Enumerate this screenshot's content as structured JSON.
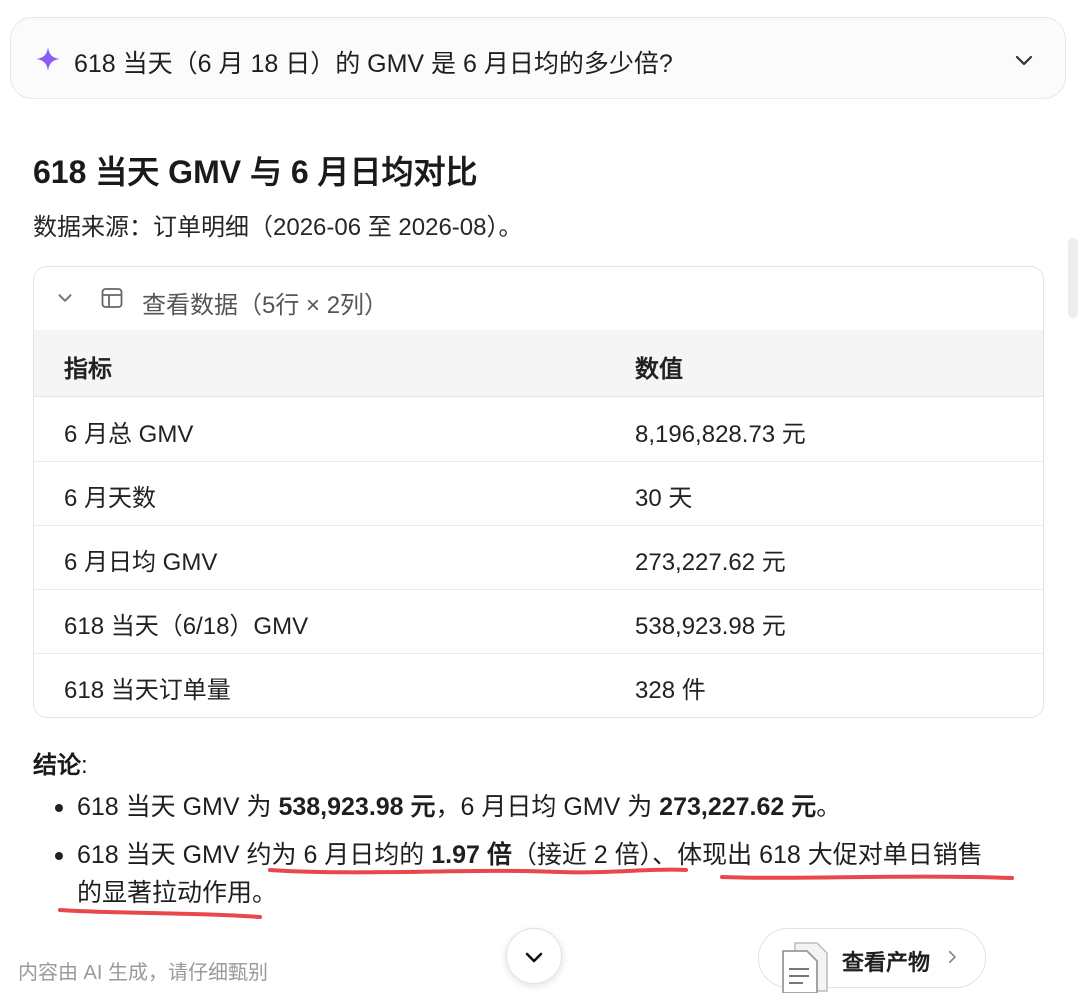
{
  "question": {
    "icon": "sparkle-icon",
    "text": "618 当天（6 月 18 日）的 GMV 是 6 月日均的多少倍?"
  },
  "answer": {
    "title": "618 当天 GMV 与 6 月日均对比",
    "source": "数据来源：订单明细（2026-06 至 2026-08）。"
  },
  "data_table": {
    "toggle_label": "查看数据（5行 × 2列）",
    "columns": [
      "指标",
      "数值"
    ],
    "rows": [
      [
        "6 月总 GMV",
        "8,196,828.73 元"
      ],
      [
        "6 月天数",
        "30 天"
      ],
      [
        "6 月日均 GMV",
        "273,227.62 元"
      ],
      [
        "618 当天（6/18）GMV",
        "538,923.98 元"
      ],
      [
        "618 当天订单量",
        "328 件"
      ]
    ]
  },
  "conclusion": {
    "label": "结论",
    "colon": ":",
    "bullet1": {
      "t1": "618 当天 GMV 为 ",
      "b1": "538,923.98 元",
      "t2": "，6 月日均 GMV 为 ",
      "b2": "273,227.62 元",
      "t3": "。"
    },
    "bullet2": {
      "t1": "618 当天 GMV 约为 6 月日均的 ",
      "b1": "1.97 倍",
      "t2": "（接近 2 倍）、体现出 618 大促对单日销售",
      "line2": "的显著拉动作用。"
    }
  },
  "footer": {
    "disclaimer": "内容由 AI 生成，请仔细甄别",
    "artifact_button": "查看产物"
  },
  "colors": {
    "accent_sparkle": "#8b5cf6",
    "annotation_red": "#e8474c"
  }
}
